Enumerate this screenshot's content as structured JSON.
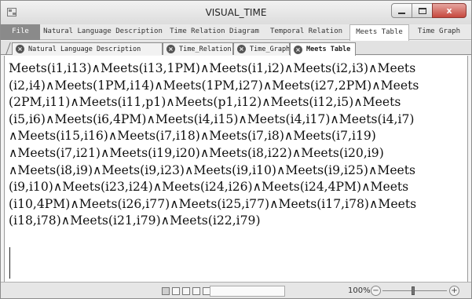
{
  "window": {
    "title": "VISUAL_TIME",
    "controls": {
      "minimize": "minimize",
      "maximize": "maximize",
      "close": "x"
    }
  },
  "ribbon": {
    "tabs": [
      {
        "label": "File"
      },
      {
        "label": "Natural Language Description"
      },
      {
        "label": "Time Relation Diagram"
      },
      {
        "label": "Temporal Relation"
      },
      {
        "label": "Meets Table",
        "active": true
      },
      {
        "label": "Time Graph"
      }
    ]
  },
  "document_tabs": [
    {
      "label": "Natural Language Description"
    },
    {
      "label": "Time_Relation"
    },
    {
      "label": "Time_Graph"
    },
    {
      "label": "Meets Table",
      "active": true
    }
  ],
  "content": {
    "meets_relations": "Meets(i1,i13)∧Meets(i13,1PM)∧Meets(i1,i2)∧Meets(i2,i3)∧Meets (i2,i4)∧Meets(1PM,i14)∧Meets(1PM,i27)∧Meets(i27,2PM)∧Meets (2PM,i11)∧Meets(i11,p1)∧Meets(p1,i12)∧Meets(i12,i5)∧Meets (i5,i6)∧Meets(i6,4PM)∧Meets(i4,i15)∧Meets(i4,i17)∧Meets(i4,i7) ∧Meets(i15,i16)∧Meets(i7,i18)∧Meets(i7,i8)∧Meets(i7,i19) ∧Meets(i7,i21)∧Meets(i19,i20)∧Meets(i8,i22)∧Meets(i20,i9) ∧Meets(i8,i9)∧Meets(i9,i23)∧Meets(i9,i10)∧Meets(i9,i25)∧Meets (i9,i10)∧Meets(i23,i24)∧Meets(i24,i26)∧Meets(i24,4PM)∧Meets (i10,4PM)∧Meets(i26,i77)∧Meets(i25,i77)∧Meets(i17,i78)∧Meets (i18,i78)∧Meets(i21,i79)∧Meets(i22,i79)"
  },
  "statusbar": {
    "zoom": "100%",
    "zoom_out": "−",
    "zoom_in": "+"
  },
  "colors": {
    "file_tab": "#8a8a8a",
    "close_button": "#c6483d"
  }
}
